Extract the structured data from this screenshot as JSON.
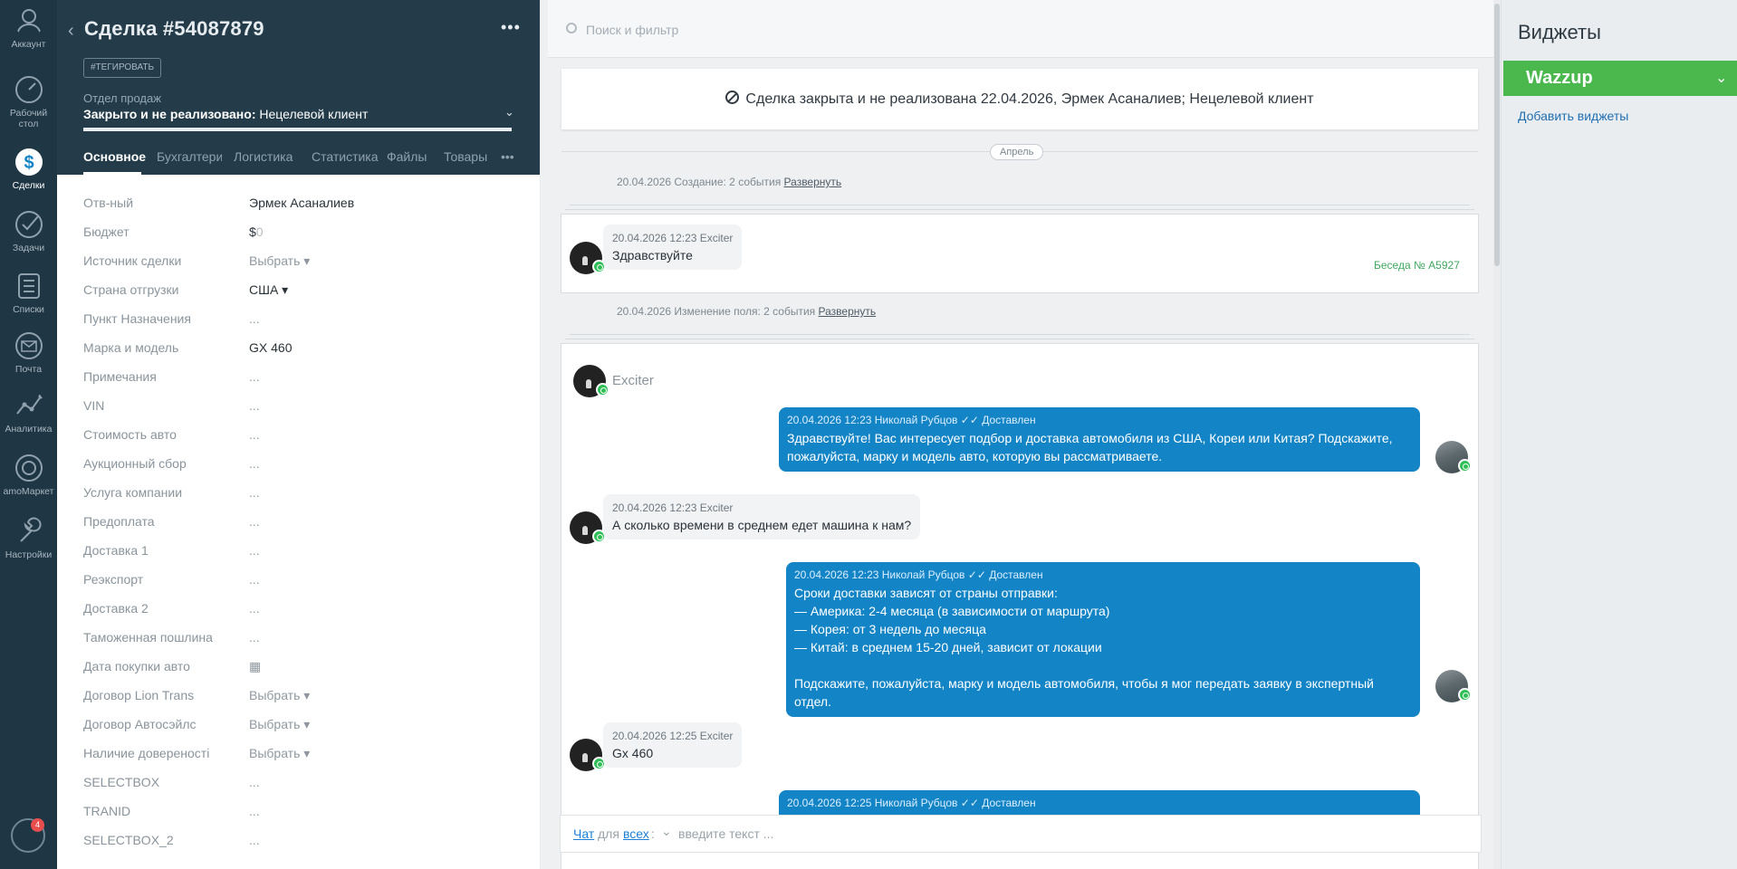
{
  "nav": {
    "items": [
      {
        "label": "Аккаунт",
        "icon": "user-avatar-icon"
      },
      {
        "label": "Рабочий стол",
        "icon": "dashboard-icon"
      },
      {
        "label": "Сделки",
        "icon": "deals-dollar-icon"
      },
      {
        "label": "Задачи",
        "icon": "tasks-check-icon"
      },
      {
        "label": "Списки",
        "icon": "lists-icon"
      },
      {
        "label": "Почта",
        "icon": "mail-icon"
      },
      {
        "label": "Аналитика",
        "icon": "analytics-icon"
      },
      {
        "label": "amoМаркет",
        "icon": "market-icon"
      },
      {
        "label": "Настройки",
        "icon": "settings-icon"
      }
    ],
    "notifications_count": "4"
  },
  "card": {
    "title": "Сделка #54087879",
    "more": "•••",
    "tag_button": "#ТЕГИРОВАТЬ",
    "pipeline": "Отдел продаж",
    "status_bold": "Закрыто и не реализовано:",
    "status_reason": "Нецелевой клиент",
    "tabs": [
      "Основное",
      "Бухгалтерия",
      "Логистика",
      "Статистика",
      "Файлы",
      "Товары",
      "•••"
    ],
    "fields": [
      {
        "label": "Отв-ный",
        "value": "Эрмек Асаналиев"
      },
      {
        "label": "Бюджет",
        "value": "$",
        "zero": "0"
      },
      {
        "label": "Источник сделки",
        "value": "Выбрать ▾"
      },
      {
        "label": "Страна отгрузки",
        "value": "США ▾"
      },
      {
        "label": "Пункт Назначения",
        "value": "..."
      },
      {
        "label": "Марка и модель",
        "value": "GX 460"
      },
      {
        "label": "Примечания",
        "value": "..."
      },
      {
        "label": "VIN",
        "value": "..."
      },
      {
        "label": "Стоимость авто",
        "value": "..."
      },
      {
        "label": "Аукционный сбор",
        "value": "..."
      },
      {
        "label": "Услуга компании",
        "value": "..."
      },
      {
        "label": "Предоплата",
        "value": "..."
      },
      {
        "label": "Доставка 1",
        "value": "..."
      },
      {
        "label": "Реэкспорт",
        "value": "..."
      },
      {
        "label": "Доставка 2",
        "value": "..."
      },
      {
        "label": "Таможенная пошлина",
        "value": "..."
      },
      {
        "label": "Дата покупки авто",
        "value": "▦"
      },
      {
        "label": "Договор Lion Trans",
        "value": "Выбрать ▾"
      },
      {
        "label": "Договор Автосэйлс",
        "value": "Выбрать ▾"
      },
      {
        "label": "Наличие довереності",
        "value": "Выбрать ▾"
      },
      {
        "label": "SELECTBOX",
        "value": "..."
      },
      {
        "label": "TRANID",
        "value": "..."
      },
      {
        "label": "SELECTBOX_2",
        "value": "..."
      }
    ]
  },
  "feed": {
    "search_placeholder": "Поиск и фильтр",
    "closed_banner": "Сделка закрыта и не реализована 22.04.2026, Эрмек Асаналиев; Нецелевой клиент",
    "month": "Апрель",
    "note1": {
      "text": "20.04.2026 Создание: 2 события",
      "link": "Развернуть"
    },
    "note2": {
      "text": "20.04.2026 Изменение поля: 2 события",
      "link": "Развернуть"
    },
    "chat1": {
      "meta": "20.04.2026 12:23 Exciter",
      "text": "Здравствуйте",
      "conversation": "Беседа № А5927"
    },
    "chat2": {
      "contact_name": "Exciter",
      "messages": [
        {
          "dir": "out",
          "meta": "20.04.2026 12:23 Николай Рубцов  ✓✓ Доставлен",
          "text": "Здравствуйте! Вас интересует подбор и доставка автомобиля из США, Кореи или Китая? Подскажите,\nпожалуйста, марку и модель авто, которую вы рассматриваете."
        },
        {
          "dir": "in",
          "meta": "20.04.2026 12:23 Exciter",
          "text": "А сколько времени в среднем едет машина к нам?"
        },
        {
          "dir": "out",
          "meta": "20.04.2026 12:23 Николай Рубцов  ✓✓ Доставлен",
          "text": "Сроки доставки зависят от страны отправки:\n— Америка: 2-4 месяца (в зависимости от маршрута)\n— Корея: от 3 недель до месяца\n— Китай: в среднем 15-20 дней, зависит от локации\n\nПодскажите, пожалуйста, марку и модель автомобиля, чтобы я мог передать заявку в экспертный отдел."
        },
        {
          "dir": "in",
          "meta": "20.04.2026 12:25 Exciter",
          "text": "Gx 460"
        },
        {
          "dir": "out",
          "meta": "20.04.2026 12:25 Николай Рубцов  ✓✓ Доставлен",
          "text": ""
        }
      ]
    },
    "composer": {
      "chat": "Чат",
      "for": "для",
      "all": "всех",
      "colon": ":",
      "chev": "⌄",
      "placeholder": "введите текст ..."
    }
  },
  "widgets": {
    "title": "Виджеты",
    "wazzup": "Wazzup",
    "add": "Добавить виджеты"
  }
}
